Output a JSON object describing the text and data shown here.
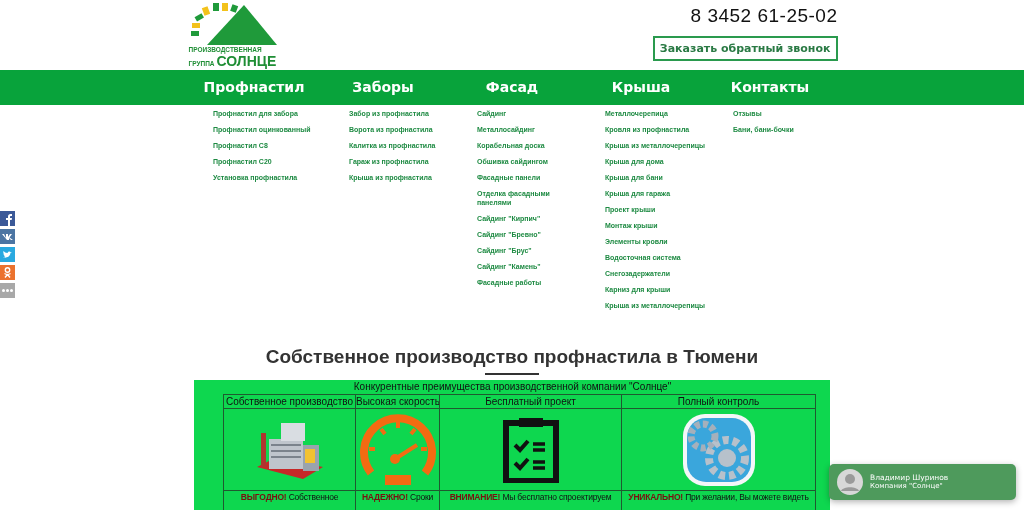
{
  "logo": {
    "line1": "ПРОИЗВОДСТВЕННАЯ",
    "line2": "ГРУППА",
    "name": "СОЛНЦЕ"
  },
  "phone": "8 3452 61-25-02",
  "callback_button": "Заказать обратный звонок",
  "nav": [
    {
      "label": "Профнастил",
      "items": [
        "Профнастил для забора",
        "Профнастил оцинкованный",
        "Профнастил С8",
        "Профнастил С20",
        "Установка профнастила"
      ]
    },
    {
      "label": "Заборы",
      "items": [
        "Забор из профнастила",
        "Ворота из профнастила",
        "Калитка из профнастила",
        "Гараж из профнастила",
        "Крыша из профнастила"
      ]
    },
    {
      "label": "Фасад",
      "items": [
        "Сайдинг",
        "Металлосайдинг",
        "Корабельная доска",
        "Обшивка сайдингом",
        "Фасадные панели",
        "Отделка фасадными панелями",
        "Сайдинг \"Кирпич\"",
        "Сайдинг \"Бревно\"",
        "Сайдинг \"Брус\"",
        "Сайдинг \"Камень\"",
        "Фасадные работы"
      ]
    },
    {
      "label": "Крыша",
      "items": [
        "Металлочерепица",
        "Кровля из профнастила",
        "Крыша из металлочерепицы",
        "Крыша для дома",
        "Крыша для бани",
        "Крыша для гаража",
        "Проект крыши",
        "Монтаж крыши",
        "Элементы кровли",
        "Водосточная система",
        "Снегозадержатели",
        "Карниз для крыши",
        "Крыша из металлочерепицы"
      ]
    },
    {
      "label": "Контакты",
      "items": [
        "Отзывы",
        "Бани, бани-бочки"
      ]
    }
  ],
  "social": [
    {
      "kind": "facebook"
    },
    {
      "kind": "vk"
    },
    {
      "kind": "twitter"
    },
    {
      "kind": "odnoklassniki"
    },
    {
      "kind": "more"
    }
  ],
  "heading": "Собственное производство профнастила в Тюмени",
  "advantages": {
    "title": "Конкурентные преимущества производственной компании \"Солнце\"",
    "columns": [
      {
        "title": "Собственное производство",
        "kind": "factory",
        "text": "**ВЫГОДНО!** Собственное"
      },
      {
        "title": "Высокая скорость",
        "kind": "speedometer",
        "text": "**НАДЕЖНО!** Сроки"
      },
      {
        "title": "Бесплатный проект",
        "kind": "checklist",
        "text": "**ВНИМАНИЕ!** Мы бесплатно спроектируем"
      },
      {
        "title": "Полный контроль",
        "kind": "gears",
        "text": "**УНИКАЛЬНО!** При желании, Вы можете видеть"
      }
    ]
  },
  "chat": {
    "name": "Владимир Шуринов",
    "company": "Компания \"Солнце\""
  }
}
